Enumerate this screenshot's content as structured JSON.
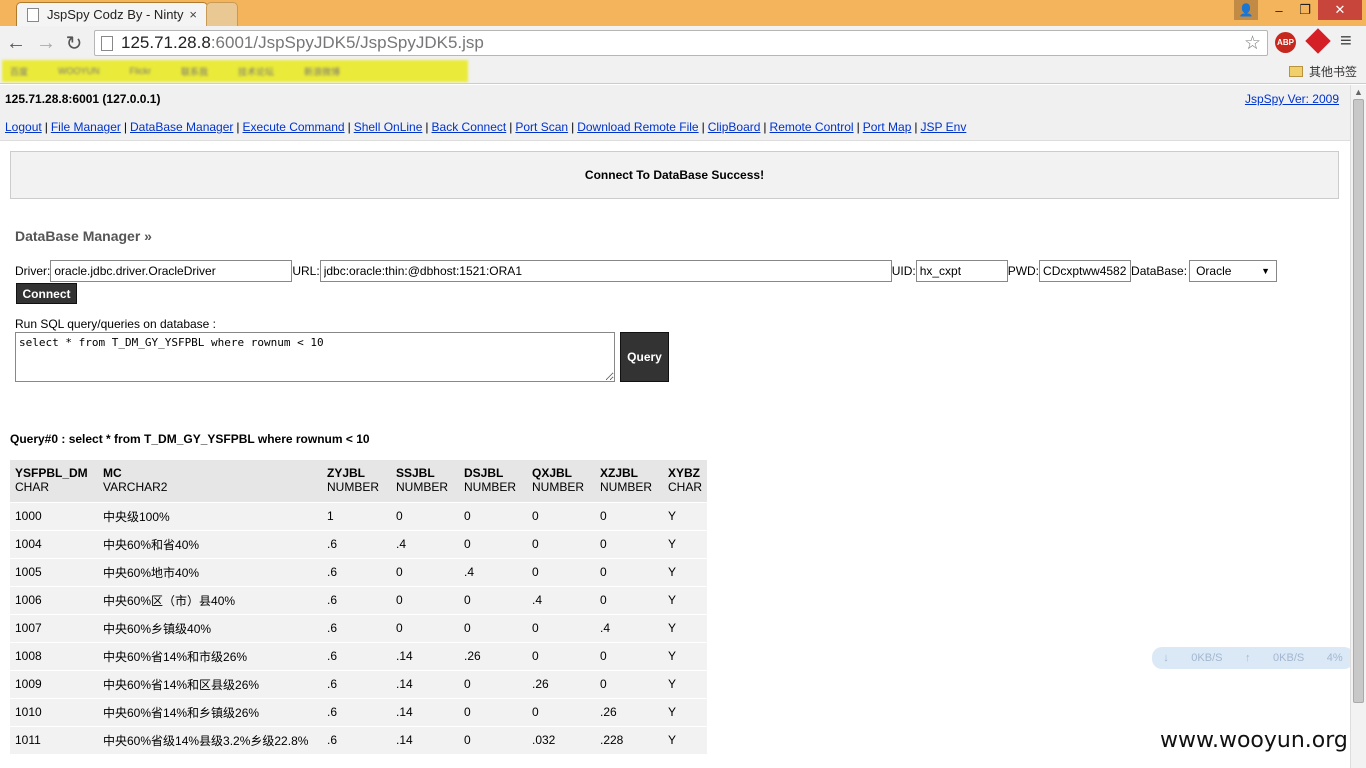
{
  "browser": {
    "tab_title": "JspSpy Codz By - Ninty",
    "tab_close": "×",
    "url_host": "125.71.28.8",
    "url_rest": ":6001/JspSpyJDK5/JspSpyJDK5.jsp",
    "abp_label": "ABP",
    "other_bookmarks": "其他书签",
    "bookmarks_blurred": [
      "百度",
      "WOOYUN",
      "Flickr",
      "联系我",
      "技术论坛",
      "新浪微博"
    ],
    "icons": {
      "back": "←",
      "forward": "→",
      "reload": "↻",
      "star": "☆",
      "menu": "≡",
      "minimize": "–",
      "maximize": "❐",
      "close": "✕",
      "user": "👤"
    }
  },
  "header": {
    "host": "125.71.28.8:6001 (127.0.0.1)",
    "version": "JspSpy Ver: 2009"
  },
  "menu": [
    "Logout",
    "File Manager",
    "DataBase Manager",
    "Execute Command",
    "Shell OnLine",
    "Back Connect",
    "Port Scan",
    "Download Remote File",
    "ClipBoard",
    "Remote Control",
    "Port Map",
    "JSP Env"
  ],
  "menu_separator": "|",
  "message": "Connect To DataBase Success!",
  "db": {
    "title": "DataBase Manager »",
    "driver_label": "Driver:",
    "driver_value": "oracle.jdbc.driver.OracleDriver",
    "url_label": "URL:",
    "url_value": "jdbc:oracle:thin:@dbhost:1521:ORA1",
    "uid_label": "UID:",
    "uid_value": "hx_cxpt",
    "pwd_label": "PWD:",
    "pwd_value": "CDcxptww4582",
    "database_label": "DataBase:",
    "database_value": "Oracle",
    "select_arrow": "▼",
    "connect_label": "Connect",
    "sql_label": "Run SQL query/queries on database :",
    "sql_value": "select * from T_DM_GY_YSFPBL where rownum < 10",
    "query_label": "Query"
  },
  "results": {
    "title": "Query#0 : select * from T_DM_GY_YSFPBL where rownum < 10",
    "columns": [
      {
        "name": "YSFPBL_DM",
        "type": "CHAR"
      },
      {
        "name": "MC",
        "type": "VARCHAR2"
      },
      {
        "name": "ZYJBL",
        "type": "NUMBER"
      },
      {
        "name": "SSJBL",
        "type": "NUMBER"
      },
      {
        "name": "DSJBL",
        "type": "NUMBER"
      },
      {
        "name": "QXJBL",
        "type": "NUMBER"
      },
      {
        "name": "XZJBL",
        "type": "NUMBER"
      },
      {
        "name": "XYBZ",
        "type": "CHAR"
      }
    ],
    "rows": [
      [
        "1000",
        "中央级100%",
        "1",
        "0",
        "0",
        "0",
        "0",
        "Y"
      ],
      [
        "1004",
        "中央60%和省40%",
        ".6",
        ".4",
        "0",
        "0",
        "0",
        "Y"
      ],
      [
        "1005",
        "中央60%地市40%",
        ".6",
        "0",
        ".4",
        "0",
        "0",
        "Y"
      ],
      [
        "1006",
        "中央60%区（市）县40%",
        ".6",
        "0",
        "0",
        ".4",
        "0",
        "Y"
      ],
      [
        "1007",
        "中央60%乡镇级40%",
        ".6",
        "0",
        "0",
        "0",
        ".4",
        "Y"
      ],
      [
        "1008",
        "中央60%省14%和市级26%",
        ".6",
        ".14",
        ".26",
        "0",
        "0",
        "Y"
      ],
      [
        "1009",
        "中央60%省14%和区县级26%",
        ".6",
        ".14",
        "0",
        ".26",
        "0",
        "Y"
      ],
      [
        "1010",
        "中央60%省14%和乡镇级26%",
        ".6",
        ".14",
        "0",
        "0",
        ".26",
        "Y"
      ],
      [
        "1011",
        "中央60%省级14%县级3.2%乡级22.8%",
        ".6",
        ".14",
        "0",
        ".032",
        ".228",
        "Y"
      ]
    ]
  },
  "speed_widget": {
    "down_icon": "↓",
    "down": "0KB/S",
    "up_icon": "↑",
    "up": "0KB/S",
    "cpu": "4%"
  },
  "watermark": "www.wooyun.org",
  "colors": {
    "link": "#0033cc",
    "titlebar": "#f3b45c",
    "button_dark": "#333333"
  }
}
